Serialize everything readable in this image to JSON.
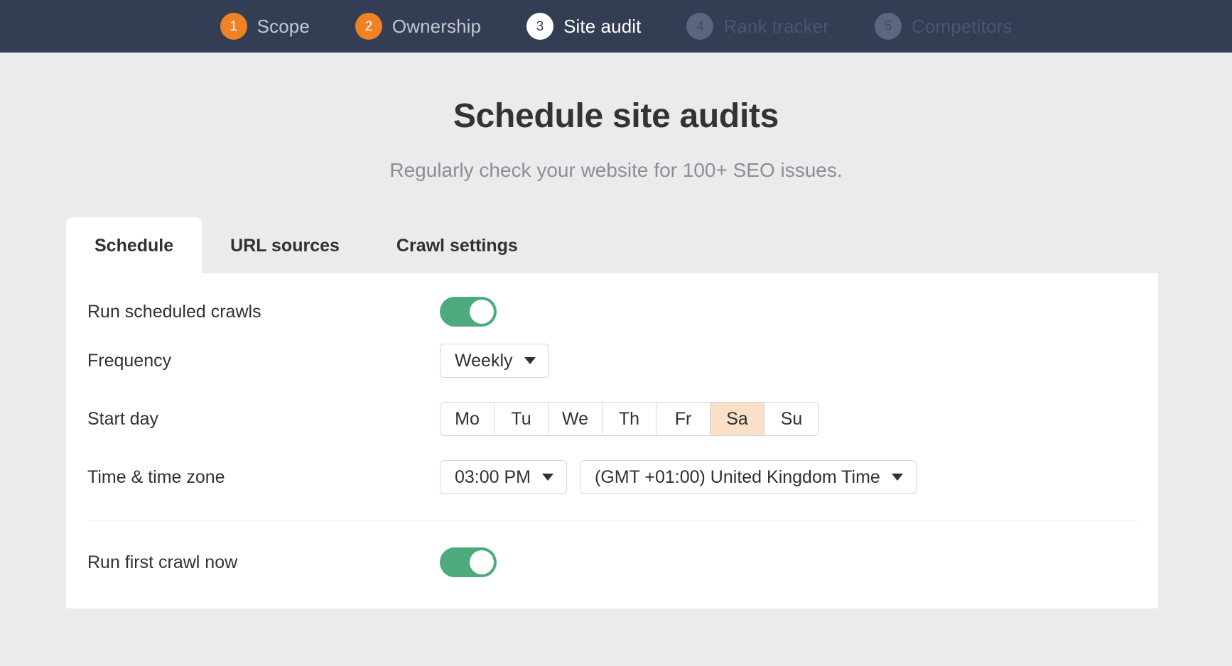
{
  "stepper": {
    "steps": [
      {
        "number": "1",
        "label": "Scope",
        "state": "done"
      },
      {
        "number": "2",
        "label": "Ownership",
        "state": "done"
      },
      {
        "number": "3",
        "label": "Site audit",
        "state": "active"
      },
      {
        "number": "4",
        "label": "Rank tracker",
        "state": "upcoming"
      },
      {
        "number": "5",
        "label": "Competitors",
        "state": "upcoming"
      }
    ],
    "bar_color": "#333d54",
    "done_color": "#f08124"
  },
  "page": {
    "title": "Schedule site audits",
    "subtitle": "Regularly check your website for 100+ SEO issues."
  },
  "tabs": [
    {
      "label": "Schedule",
      "active": true
    },
    {
      "label": "URL sources",
      "active": false
    },
    {
      "label": "Crawl settings",
      "active": false
    }
  ],
  "form": {
    "run_scheduled_crawls": {
      "label": "Run scheduled crawls",
      "value": "on"
    },
    "frequency": {
      "label": "Frequency",
      "value": "Weekly"
    },
    "start_day": {
      "label": "Start day",
      "days": [
        "Mo",
        "Tu",
        "We",
        "Th",
        "Fr",
        "Sa",
        "Su"
      ],
      "selected": "Sa",
      "selected_color": "#fae0c7"
    },
    "time_zone": {
      "label": "Time & time zone",
      "time_value": "03:00 PM",
      "zone_value": "(GMT +01:00) United Kingdom Time"
    },
    "run_first_crawl_now": {
      "label": "Run first crawl now",
      "value": "on"
    },
    "toggle_on_color": "#4caa7c"
  }
}
